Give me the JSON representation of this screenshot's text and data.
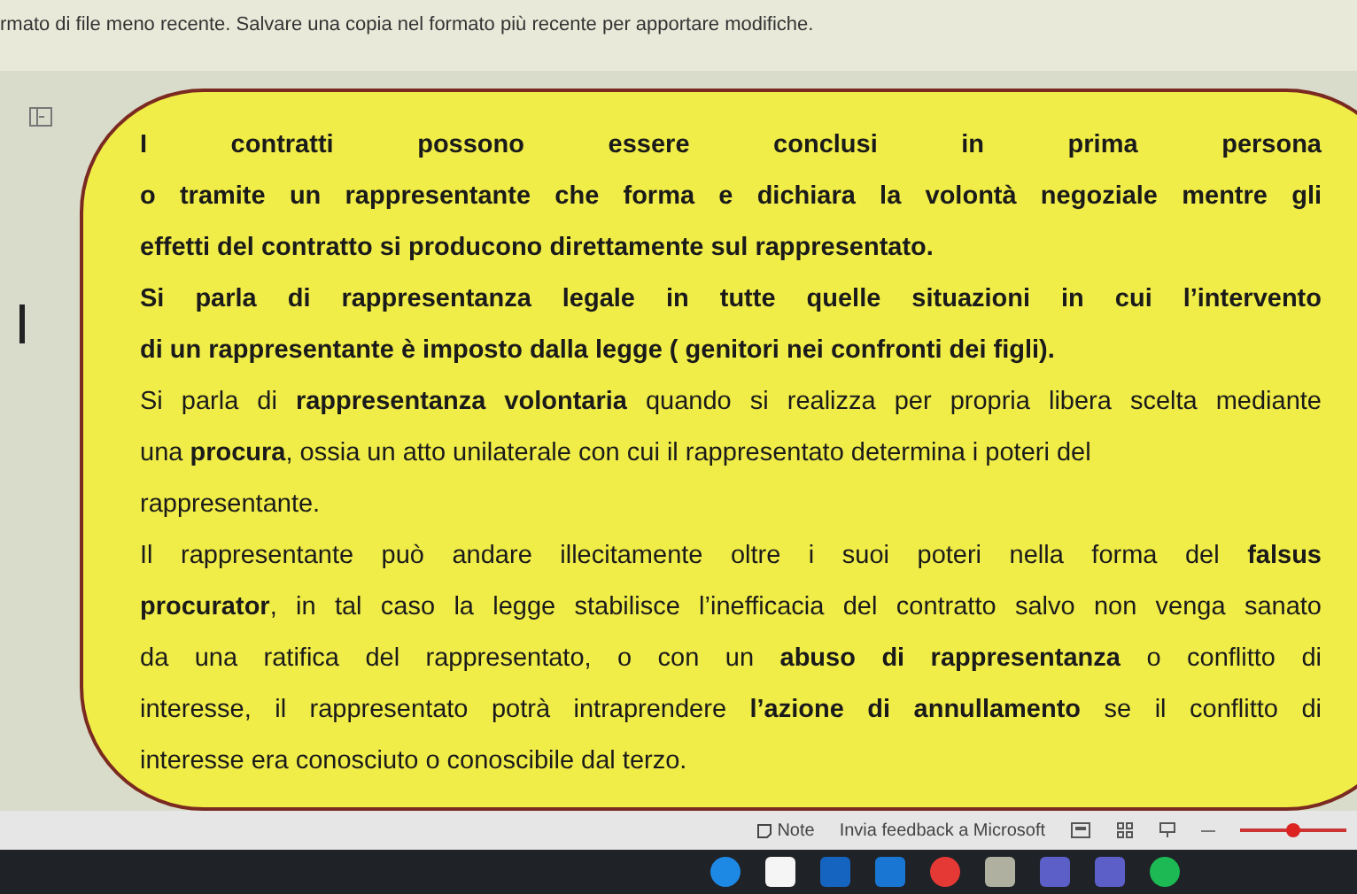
{
  "info_bar": {
    "message": "rmato di file meno recente. Salvare una copia nel formato più recente per apportare modifiche."
  },
  "document": {
    "lines": [
      {
        "text": "I contratti possono essere conclusi in prima persona",
        "bold": true,
        "justify": true
      },
      {
        "text": "o tramite un rappresentante che forma e dichiara la volontà negoziale mentre gli",
        "bold": true,
        "justify": true
      },
      {
        "text": "effetti del contratto si producono direttamente sul rappresentato.",
        "bold": true,
        "justify": false
      },
      {
        "text": "Si parla di rappresentanza legale in tutte quelle situazioni in cui l’intervento",
        "bold": true,
        "justify": true
      },
      {
        "text": "di un rappresentante è imposto dalla legge ( genitori nei confronti dei figli).",
        "bold": true,
        "justify": false
      },
      {
        "text": "Si parla di **rappresentanza volontaria** quando si realizza per propria libera scelta mediante",
        "bold": false,
        "justify": true
      },
      {
        "text": "una **procura**, ossia un atto unilaterale con cui il rappresentato determina i poteri del",
        "bold": false,
        "justify": false
      },
      {
        "text": "rappresentante.",
        "bold": false,
        "justify": false
      },
      {
        "text": "Il rappresentante può andare illecitamente oltre i suoi poteri nella forma del **falsus**",
        "bold": false,
        "justify": true
      },
      {
        "text": "**procurator**, in tal caso la legge stabilisce l’inefficacia del contratto salvo non venga sanato",
        "bold": false,
        "justify": true
      },
      {
        "text": "da una ratifica del rappresentato, o con un **abuso di rappresentanza** o conflitto di",
        "bold": false,
        "justify": true
      },
      {
        "text": "interesse, il rappresentato potrà intraprendere **l’azione di annullamento** se il conflitto di",
        "bold": false,
        "justify": true
      },
      {
        "text": "interesse era conosciuto o conoscibile dal terzo.",
        "bold": false,
        "justify": false
      }
    ]
  },
  "status_bar": {
    "notes": "Note",
    "feedback": "Invia feedback a Microsoft",
    "zoom": {
      "level": 0.5
    }
  }
}
